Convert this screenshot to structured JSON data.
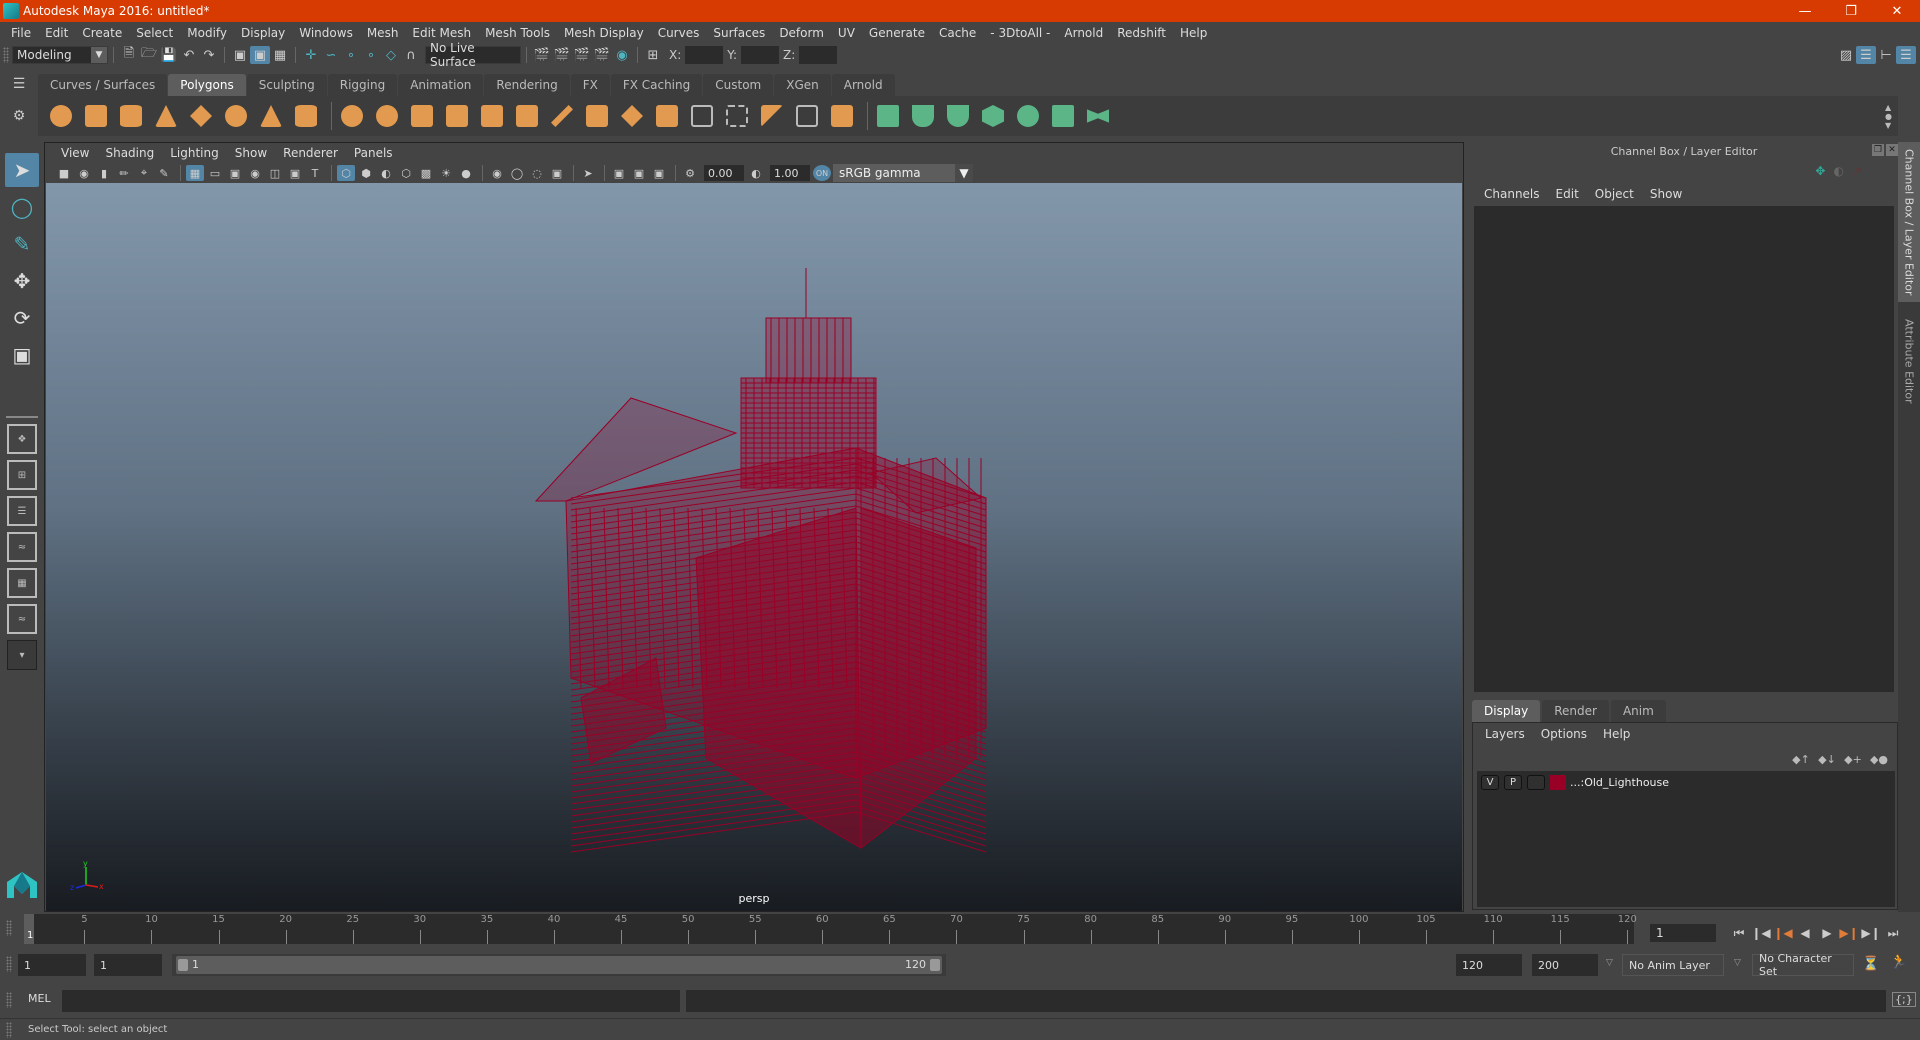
{
  "window": {
    "title": "Autodesk Maya 2016: untitled*",
    "controls": [
      "minimize",
      "restore",
      "close"
    ]
  },
  "menubar": [
    "File",
    "Edit",
    "Create",
    "Select",
    "Modify",
    "Display",
    "Windows",
    "Mesh",
    "Edit Mesh",
    "Mesh Tools",
    "Mesh Display",
    "Curves",
    "Surfaces",
    "Deform",
    "UV",
    "Generate",
    "Cache",
    "- 3DtoAll -",
    "Arnold",
    "Redshift",
    "Help"
  ],
  "statusline": {
    "menuset": "Modeling",
    "live_surface": "No Live Surface",
    "x_label": "X:",
    "y_label": "Y:",
    "z_label": "Z:"
  },
  "shelf": {
    "tabs": [
      "Curves / Surfaces",
      "Polygons",
      "Sculpting",
      "Rigging",
      "Animation",
      "Rendering",
      "FX",
      "FX Caching",
      "Custom",
      "XGen",
      "Arnold"
    ],
    "active_tab": "Polygons",
    "accent_orange": "#e19a4f",
    "accent_green": "#5bb586"
  },
  "viewport": {
    "menu": [
      "View",
      "Shading",
      "Lighting",
      "Show",
      "Renderer",
      "Panels"
    ],
    "exposure": "0.00",
    "gamma": "1.00",
    "color_space": "sRGB gamma",
    "camera_label": "persp",
    "wire_color": "#990026",
    "axis": {
      "x": "x",
      "y": "y",
      "z": "z"
    }
  },
  "channel_box": {
    "title": "Channel Box / Layer Editor",
    "menu": [
      "Channels",
      "Edit",
      "Object",
      "Show"
    ]
  },
  "layer_editor": {
    "tabs": [
      "Display",
      "Render",
      "Anim"
    ],
    "active_tab": "Display",
    "menu": [
      "Layers",
      "Options",
      "Help"
    ],
    "layers": [
      {
        "v": "V",
        "p": "P",
        "color": "#990026",
        "name": "...:Old_Lighthouse"
      }
    ]
  },
  "side_tabs": [
    "Channel Box / Layer Editor",
    "Attribute Editor"
  ],
  "timeline": {
    "ticks": [
      "5",
      "10",
      "15",
      "20",
      "25",
      "30",
      "35",
      "40",
      "45",
      "50",
      "55",
      "60",
      "65",
      "70",
      "75",
      "80",
      "85",
      "90",
      "95",
      "100",
      "105",
      "110",
      "115",
      "120"
    ],
    "current_frame_label": "1",
    "current_frame": "1",
    "start": 1,
    "end": 120
  },
  "range": {
    "anim_start": "1",
    "play_start": "1",
    "slider_start": "1",
    "slider_end": "120",
    "play_end": "120",
    "anim_end": "200",
    "anim_layer": "No Anim Layer",
    "character_set": "No Character Set"
  },
  "command_line": {
    "label": "MEL"
  },
  "status_message": "Select Tool: select an object"
}
